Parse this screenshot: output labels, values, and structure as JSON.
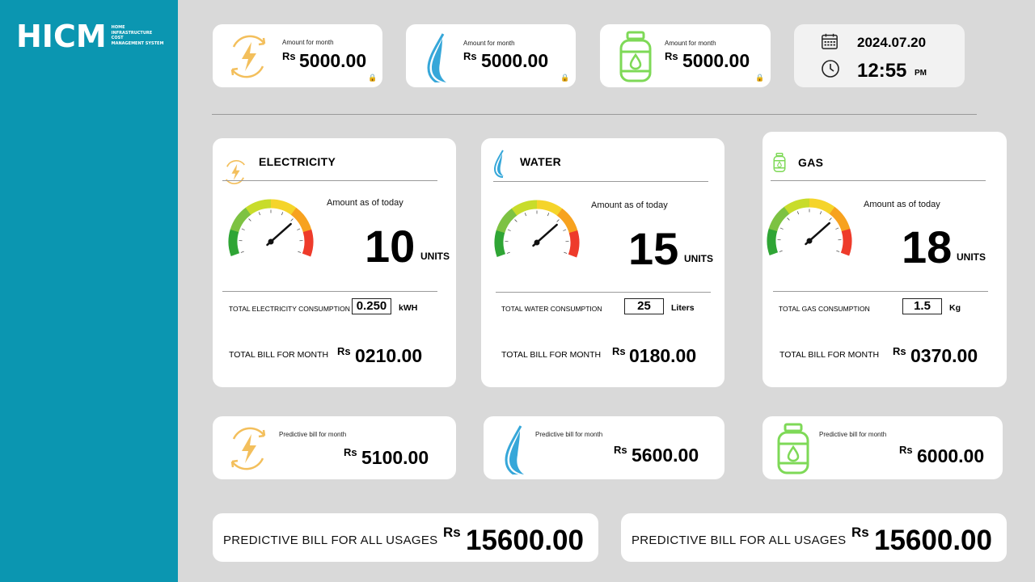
{
  "brand": {
    "logo": "HICM",
    "subtitle_lines": [
      "HOME",
      "INFRASTRUCTURE",
      "COST",
      "MANAGEMENT SYSTEM"
    ]
  },
  "summary": [
    {
      "icon": "electricity-bolt-icon",
      "label": "Amount for month",
      "currency": "Rs",
      "value": "5000.00",
      "color": "#f3bf5c"
    },
    {
      "icon": "water-drop-icon",
      "label": "Amount for month",
      "currency": "Rs",
      "value": "5000.00",
      "color": "#36a7d9"
    },
    {
      "icon": "gas-cylinder-icon",
      "label": "Amount for month",
      "currency": "Rs",
      "value": "5000.00",
      "color": "#7ed957"
    }
  ],
  "datetime": {
    "date": "2024.07.20",
    "time": "12:55",
    "ampm": "PM",
    "date_icon": "calendar-icon",
    "time_icon": "clock-icon"
  },
  "utilities": [
    {
      "title": "ELECTRICITY",
      "caption": "Amount as of today",
      "value": "10",
      "unit": "UNITS",
      "gauge_value": 0.72,
      "cons_label": "TOTAL ELECTRICITY CONSUMPTION",
      "cons_value": "0.250",
      "cons_unit": "kWH",
      "bill_label": "TOTAL BILL FOR MONTH",
      "bill_currency": "Rs",
      "bill_value": "0210.00"
    },
    {
      "title": "WATER",
      "caption": "Amount as of today",
      "value": "15",
      "unit": "UNITS",
      "gauge_value": 0.72,
      "cons_label": "TOTAL WATER CONSUMPTION",
      "cons_value": "25",
      "cons_unit": "Liters",
      "bill_label": "TOTAL BILL FOR MONTH",
      "bill_currency": "Rs",
      "bill_value": "0180.00"
    },
    {
      "title": "GAS",
      "caption": "Amount as of today",
      "value": "18",
      "unit": "UNITS",
      "gauge_value": 0.72,
      "cons_label": "TOTAL GAS CONSUMPTION",
      "cons_value": "1.5",
      "cons_unit": "Kg",
      "bill_label": "TOTAL BILL FOR MONTH",
      "bill_currency": "Rs",
      "bill_value": "0370.00"
    }
  ],
  "predictive": [
    {
      "label": "Predictive bill for month",
      "currency": "Rs",
      "value": "5100.00"
    },
    {
      "label": "Predictive bill for month",
      "currency": "Rs",
      "value": "5600.00"
    },
    {
      "label": "Predictive bill for month",
      "currency": "Rs",
      "value": "6000.00"
    }
  ],
  "totals": [
    {
      "label": "PREDICTIVE BILL FOR ALL USAGES",
      "currency": "Rs",
      "value": "15600.00"
    },
    {
      "label": "PREDICTIVE BILL FOR ALL USAGES",
      "currency": "Rs",
      "value": "15600.00"
    }
  ]
}
